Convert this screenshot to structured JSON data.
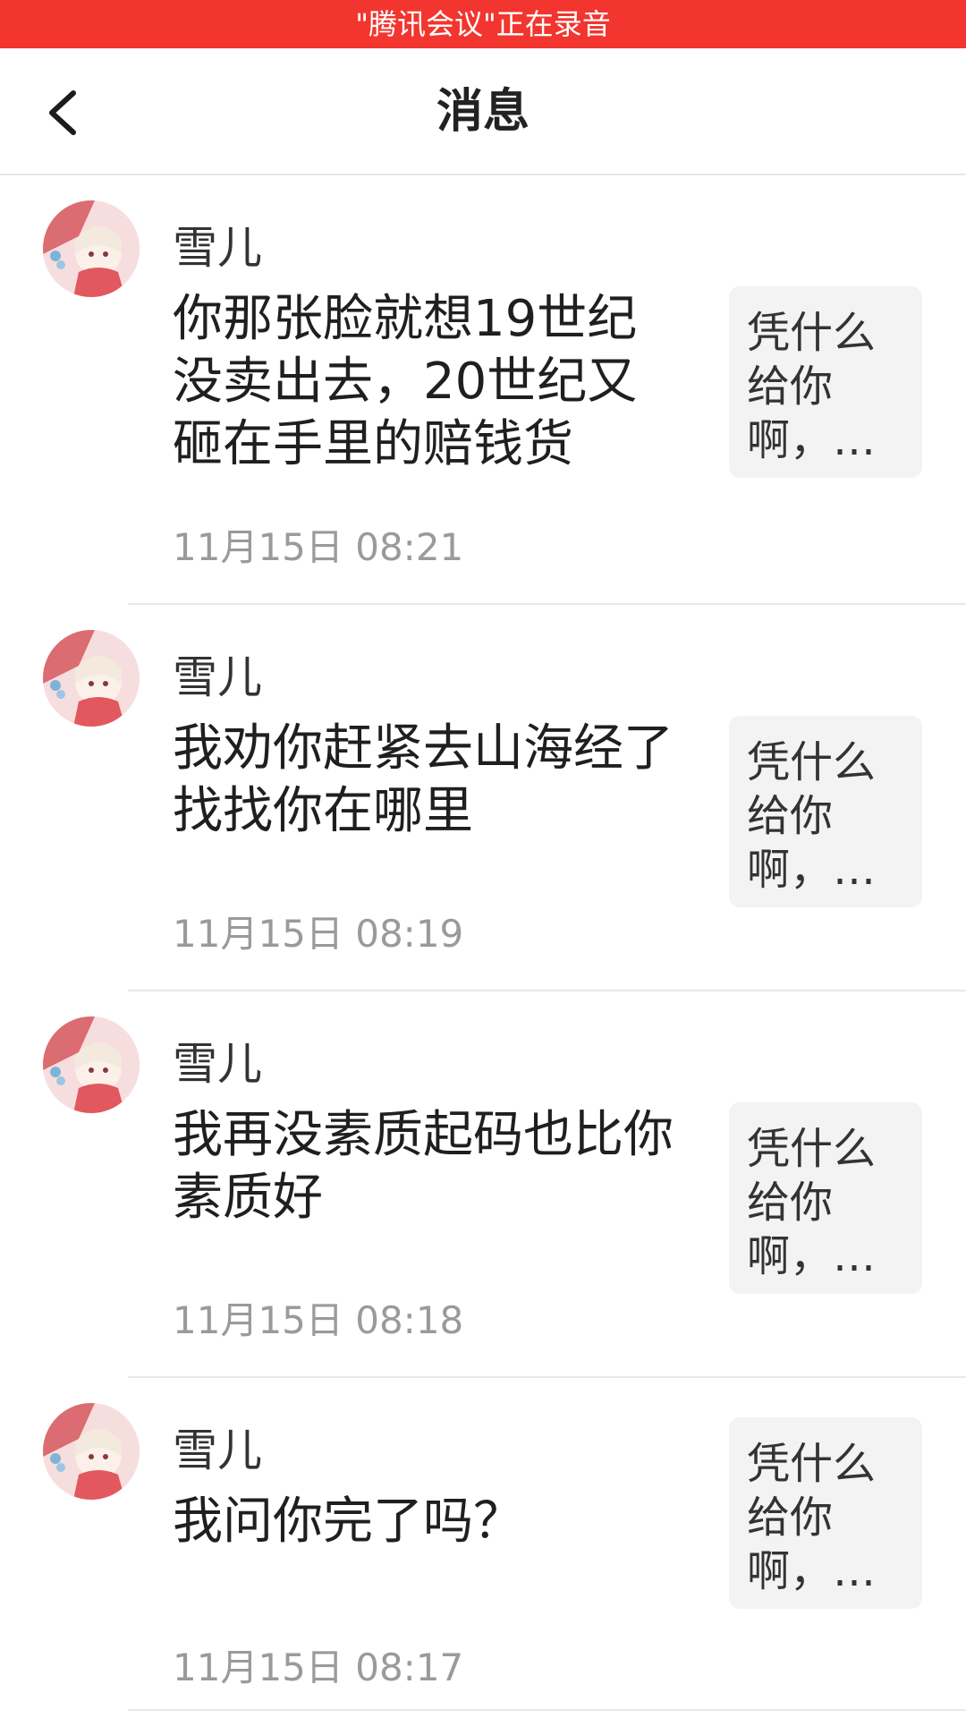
{
  "status_banner": {
    "text": "\"腾讯会议\"正在录音",
    "color": "#f2352f"
  },
  "nav": {
    "back_icon": "chevron-left-icon",
    "title": "消息"
  },
  "messages": [
    {
      "sender": "雪儿",
      "body": "你那张脸就想19世纪没卖出去，20世纪又砸在手里的赔钱货",
      "time": "11月15日 08:21",
      "quote": "凭什么给你啊，…"
    },
    {
      "sender": "雪儿",
      "body": "我劝你赶紧去山海经了找找你在哪里",
      "time": "11月15日 08:19",
      "quote": "凭什么给你啊，…"
    },
    {
      "sender": "雪儿",
      "body": "我再没素质起码也比你素质好",
      "time": "11月15日 08:18",
      "quote": "凭什么给你啊，…"
    },
    {
      "sender": "雪儿",
      "body": "我问你完了吗？",
      "time": "11月15日 08:17",
      "quote": "凭什么给你啊，…"
    }
  ]
}
